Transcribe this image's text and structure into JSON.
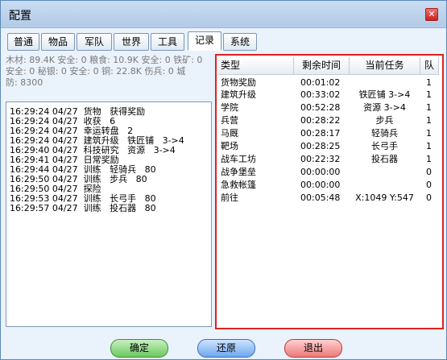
{
  "window": {
    "title": "配置",
    "close_symbol": "✕"
  },
  "tabs": [
    {
      "label": "普通"
    },
    {
      "label": "物品"
    },
    {
      "label": "军队"
    },
    {
      "label": "世界"
    },
    {
      "label": "工具"
    },
    {
      "label": "记录",
      "active": true
    },
    {
      "label": "系统"
    }
  ],
  "resources": {
    "line1": "木材: 89.4K 安全: 0   粮食: 10.9K 安全: 0   铁矿: 0",
    "line2": "安全: 0   秘银: 0 安全: 0   铜: 22.8K   伤兵: 0   城",
    "line3": "防: 8300"
  },
  "log": [
    "16:29:24 04/27  货物   获得奖励",
    "16:29:24 04/27  收获   6",
    "16:29:24 04/27  幸运转盘   2",
    "16:29:24 04/27  建筑升级   铁匠铺   3->4",
    "16:29:40 04/27  科技研究   资源   3->4",
    "16:29:41 04/27  日常奖励",
    "16:29:44 04/27  训练   轻骑兵   80",
    "16:29:50 04/27  训练   步兵   80",
    "16:29:50 04/27  探险",
    "16:29:53 04/27  训练   长弓手   80",
    "16:29:57 04/27  训练   投石器   80"
  ],
  "task_table": {
    "headers": [
      "类型",
      "剩余时间",
      "当前任务",
      "队"
    ],
    "rows": [
      [
        "货物奖励",
        "00:01:02",
        "",
        "1"
      ],
      [
        "建筑升级",
        "00:33:02",
        "铁匠铺 3->4",
        "1"
      ],
      [
        "学院",
        "00:52:28",
        "资源 3->4",
        "1"
      ],
      [
        "兵营",
        "00:28:22",
        "步兵",
        "1"
      ],
      [
        "马厩",
        "00:28:17",
        "轻骑兵",
        "1"
      ],
      [
        "靶场",
        "00:28:25",
        "长弓手",
        "1"
      ],
      [
        "战车工坊",
        "00:22:32",
        "投石器",
        "1"
      ],
      [
        "战争堡垒",
        "00:00:00",
        "",
        "0"
      ],
      [
        "急救帐篷",
        "00:00:00",
        "",
        "0"
      ],
      [
        "前往",
        "00:05:48",
        "X:1049 Y:547",
        "0"
      ]
    ]
  },
  "buttons": {
    "ok": "确定",
    "restore": "还原",
    "exit": "退出"
  },
  "colors": {
    "highlight_border": "#e02020",
    "ok": "#6cc860",
    "restore": "#6ea8ef",
    "exit": "#ee7a7a"
  }
}
